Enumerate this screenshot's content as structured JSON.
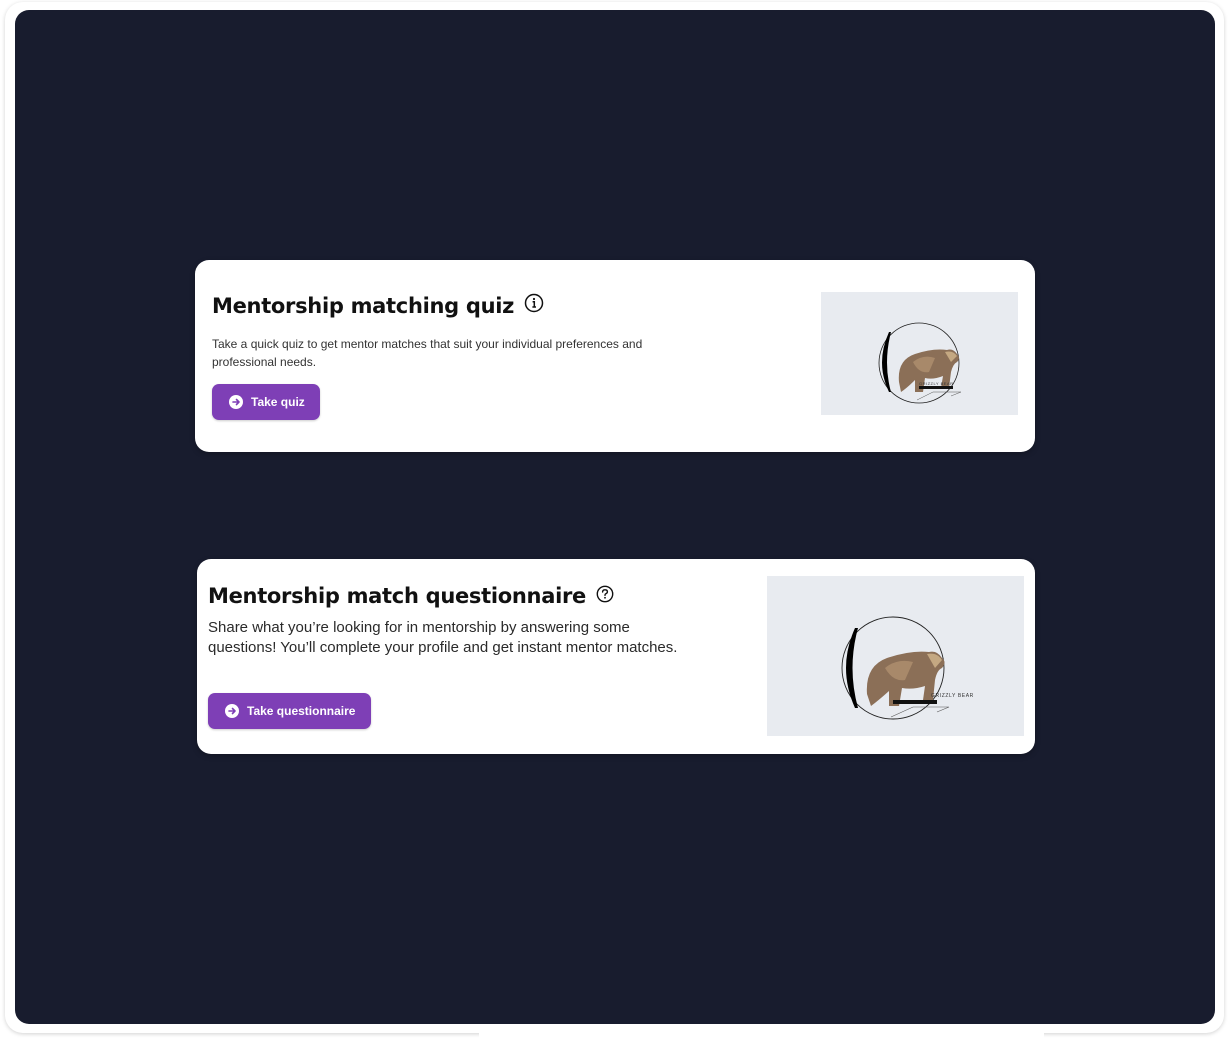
{
  "cards": [
    {
      "title": "Mentorship matching quiz",
      "title_icon": "info-circle-icon",
      "description": "Take a quick quiz to get mentor matches that suit your individual preferences and professional needs.",
      "button_label": "Take quiz",
      "button_icon": "arrow-right-circle-icon",
      "image_caption": "GRIZZLY BEAR"
    },
    {
      "title": "Mentorship match questionnaire",
      "title_icon": "question-circle-icon",
      "description": "Share what you’re looking for in mentorship by answering some questions! You’ll complete your profile and get instant mentor matches.",
      "button_label": "Take questionnaire",
      "button_icon": "arrow-right-circle-icon",
      "image_caption": "GRIZZLY BEAR"
    }
  ],
  "colors": {
    "background": "#181c2e",
    "card": "#ffffff",
    "button": "#7e3fb6",
    "thumbnail": "#e8ebf0"
  }
}
